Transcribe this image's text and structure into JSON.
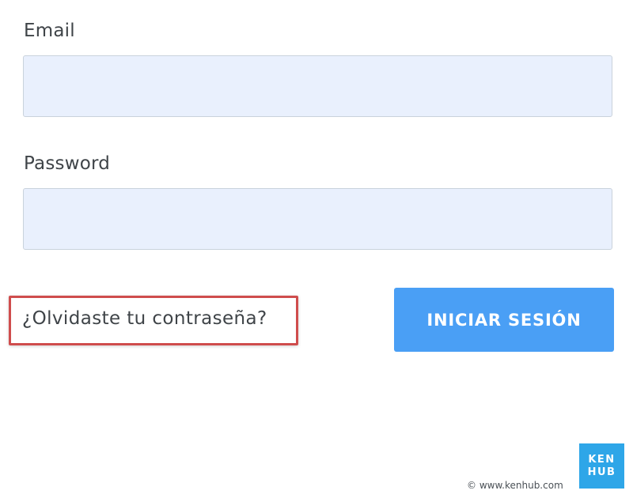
{
  "form": {
    "email": {
      "label": "Email",
      "value": "",
      "placeholder": ""
    },
    "password": {
      "label": "Password",
      "value": "",
      "placeholder": ""
    },
    "forgot_password_label": "¿Olvidaste tu contraseña?",
    "submit_label": "INICIAR SESIÓN"
  },
  "footer": {
    "copyright": "© www.kenhub.com",
    "logo_line1": "KEN",
    "logo_line2": "HUB"
  },
  "colors": {
    "input_background": "#e9f0fd",
    "button_background": "#4a9ff5",
    "highlight_border": "#cf4d4d",
    "logo_background": "#2ea6e8"
  }
}
